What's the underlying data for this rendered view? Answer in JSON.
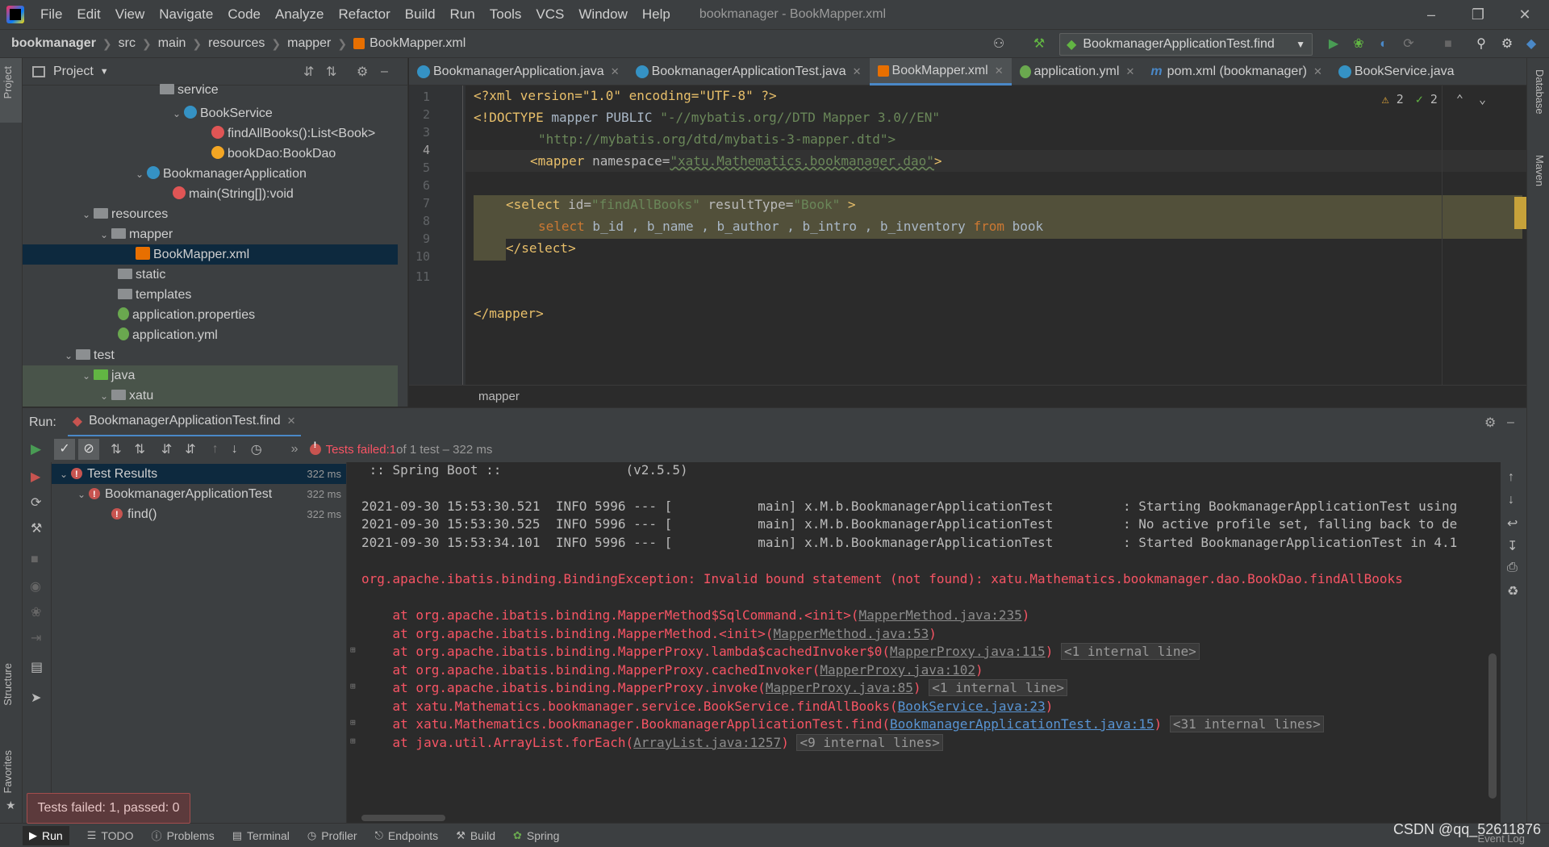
{
  "menubar": {
    "items": [
      "File",
      "Edit",
      "View",
      "Navigate",
      "Code",
      "Analyze",
      "Refactor",
      "Build",
      "Run",
      "Tools",
      "VCS",
      "Window",
      "Help"
    ],
    "title": "bookmanager - BookMapper.xml"
  },
  "navbar": {
    "crumbs": [
      "bookmanager",
      "src",
      "main",
      "resources",
      "mapper",
      "BookMapper.xml"
    ],
    "run_config": "BookmanagerApplicationTest.find"
  },
  "project": {
    "header": "Project",
    "rows": [
      {
        "label": "service",
        "level": 5
      },
      {
        "label": "BookService",
        "level": 6
      },
      {
        "label": "findAllBooks():List<Book>",
        "level": 7
      },
      {
        "label": "bookDao:BookDao",
        "level": 7
      },
      {
        "label": "BookmanagerApplication",
        "level": 5
      },
      {
        "label": "main(String[]):void",
        "level": 6
      },
      {
        "label": "resources",
        "level": 3
      },
      {
        "label": "mapper",
        "level": 4
      },
      {
        "label": "BookMapper.xml",
        "level": 5
      },
      {
        "label": "static",
        "level": 4
      },
      {
        "label": "templates",
        "level": 4
      },
      {
        "label": "application.properties",
        "level": 4
      },
      {
        "label": "application.yml",
        "level": 4
      },
      {
        "label": "test",
        "level": 2
      },
      {
        "label": "java",
        "level": 3
      },
      {
        "label": "xatu",
        "level": 4
      },
      {
        "label": "Mathematics",
        "level": 5
      }
    ]
  },
  "editor": {
    "tabs": [
      "BookmanagerApplication.java",
      "BookmanagerApplicationTest.java",
      "BookMapper.xml",
      "application.yml",
      "pom.xml (bookmanager)",
      "BookService.java"
    ],
    "line_numbers": [
      "1",
      "2",
      "3",
      "4",
      "5",
      "6",
      "7",
      "8",
      "9",
      "10",
      "11"
    ],
    "inspection_warnings": "2",
    "inspection_ok": "2",
    "breadcrumb": "mapper"
  },
  "code": {
    "l1": "<?xml version=\"1.0\" encoding=\"UTF-8\" ?>",
    "l2a": "<!DOCTYPE",
    "l2b": " mapper PUBLIC ",
    "l2c": "\"-//mybatis.org//DTD Mapper 3.0//EN\"",
    "l3": "\"http://mybatis.org/dtd/mybatis-3-mapper.dtd\">",
    "l4a": "<mapper",
    "l4b": " namespace=",
    "l4c": "\"xatu.Mathematics.bookmanager.dao\"",
    "l4d": ">",
    "l6a": "<select",
    "l6b": " id=",
    "l6c": "\"findAllBooks\"",
    "l6d": " resultType=",
    "l6e": "\"Book\"",
    "l6f": " >",
    "l7a": "select",
    "l7b": " b_id , b_name , b_author , b_intro , b_inventory ",
    "l7c": "from",
    "l7d": " book",
    "l8": "</select>",
    "l11": "</mapper>"
  },
  "run": {
    "label": "Run:",
    "tab": "BookmanagerApplicationTest.find",
    "status_prefix": "Tests failed: ",
    "status_count": "1",
    "status_suffix": " of 1 test – 322 ms"
  },
  "tests": {
    "root": "Test Results",
    "root_time": "322 ms",
    "class": "BookmanagerApplicationTest",
    "class_time": "322 ms",
    "method": "find()",
    "method_time": "322 ms"
  },
  "console": {
    "l0": " :: Spring Boot ::                (v2.5.5)",
    "l1": "2021-09-30 15:53:30.521  INFO 5996 --- [           main] x.M.b.BookmanagerApplicationTest         : Starting BookmanagerApplicationTest using",
    "l2": "2021-09-30 15:53:30.525  INFO 5996 --- [           main] x.M.b.BookmanagerApplicationTest         : No active profile set, falling back to de",
    "l3": "2021-09-30 15:53:34.101  INFO 5996 --- [           main] x.M.b.BookmanagerApplicationTest         : Started BookmanagerApplicationTest in 4.1",
    "exc": "org.apache.ibatis.binding.BindingException: Invalid bound statement (not found): xatu.Mathematics.bookmanager.dao.BookDao.findAllBooks",
    "s1a": "    at org.apache.ibatis.binding.MapperMethod$SqlCommand.<init>(",
    "s1l": "MapperMethod.java:235",
    "s1b": ")",
    "s2a": "    at org.apache.ibatis.binding.MapperMethod.<init>(",
    "s2l": "MapperMethod.java:53",
    "s2b": ")",
    "s3a": "    at org.apache.ibatis.binding.MapperProxy.lambda$cachedInvoker$0(",
    "s3l": "MapperProxy.java:115",
    "s3b": ")",
    "s3i": "<1 internal line>",
    "s4a": "    at org.apache.ibatis.binding.MapperProxy.cachedInvoker(",
    "s4l": "MapperProxy.java:102",
    "s4b": ")",
    "s5a": "    at org.apache.ibatis.binding.MapperProxy.invoke(",
    "s5l": "MapperProxy.java:85",
    "s5b": ")",
    "s5i": "<1 internal line>",
    "s6a": "    at xatu.Mathematics.bookmanager.service.BookService.findAllBooks(",
    "s6l": "BookService.java:23",
    "s6b": ")",
    "s7a": "    at xatu.Mathematics.bookmanager.BookmanagerApplicationTest.find(",
    "s7l": "BookmanagerApplicationTest.java:15",
    "s7b": ")",
    "s7i": "<31 internal lines>",
    "s8a": "    at java.util.ArrayList.forEach(",
    "s8l": "ArrayList.java:1257",
    "s8b": ")",
    "s8i": "<9 internal lines>"
  },
  "bottom": {
    "tabs": [
      "Run",
      "TODO",
      "Problems",
      "Terminal",
      "Profiler",
      "Endpoints",
      "Build",
      "Spring"
    ],
    "toast": "Tests failed: 1, passed: 0",
    "watermark": "CSDN @qq_52611876",
    "event_log": "Event Log"
  },
  "side_tabs": {
    "project": "Project",
    "structure": "Structure",
    "favorites": "Favorites",
    "database": "Database",
    "maven": "Maven"
  },
  "colors": {
    "accent": "#4a88c7",
    "error": "#f75464",
    "run_green": "#499c54"
  }
}
